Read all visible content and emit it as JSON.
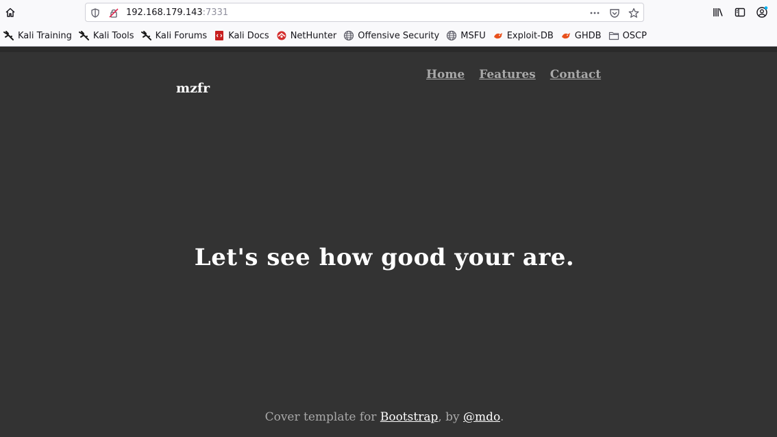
{
  "browser": {
    "url_host": "192.168.179.143",
    "url_port": ":7331",
    "bookmarks": [
      {
        "label": "Kali Training",
        "icon": "kali-dragon-icon"
      },
      {
        "label": "Kali Tools",
        "icon": "kali-dragon-icon"
      },
      {
        "label": "Kali Forums",
        "icon": "kali-dragon-icon"
      },
      {
        "label": "Kali Docs",
        "icon": "kali-docs-icon"
      },
      {
        "label": "NetHunter",
        "icon": "nethunter-icon"
      },
      {
        "label": "Offensive Security",
        "icon": "globe-icon"
      },
      {
        "label": "MSFU",
        "icon": "globe-icon"
      },
      {
        "label": "Exploit-DB",
        "icon": "exploit-db-icon"
      },
      {
        "label": "GHDB",
        "icon": "exploit-db-icon"
      },
      {
        "label": "OSCP",
        "icon": "folder-icon"
      }
    ]
  },
  "page": {
    "brand": "mzfr",
    "nav": [
      "Home",
      "Features",
      "Contact"
    ],
    "headline": "Let's see how good your are.",
    "footer": {
      "prefix": "Cover template for ",
      "link1": "Bootstrap",
      "middle": ", by ",
      "link2": "@mdo",
      "suffix": "."
    }
  },
  "colors": {
    "page_background": "#333333",
    "nav_link": "#a9a9a9",
    "heading": "#ffffff"
  }
}
